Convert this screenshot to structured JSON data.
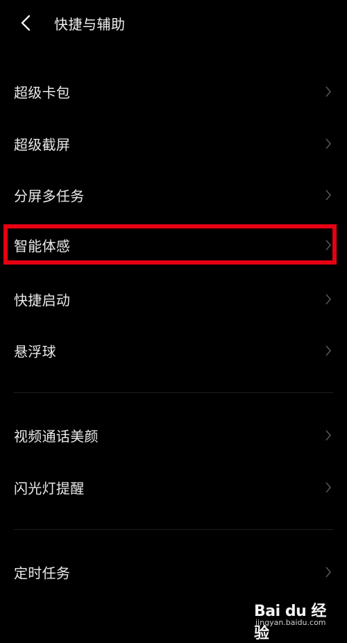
{
  "header": {
    "title": "快捷与辅助",
    "back_icon": "chevron-left-icon"
  },
  "groups": [
    {
      "items": [
        {
          "label": "超级卡包"
        },
        {
          "label": "超级截屏"
        },
        {
          "label": "分屏多任务"
        },
        {
          "label": "智能体感",
          "highlighted": true
        },
        {
          "label": "快捷启动"
        },
        {
          "label": "悬浮球"
        }
      ]
    },
    {
      "items": [
        {
          "label": "视频通话美颜"
        },
        {
          "label": "闪光灯提醒"
        }
      ]
    },
    {
      "items": [
        {
          "label": "定时任务"
        }
      ]
    }
  ],
  "chevron_icon": "chevron-right-icon",
  "colors": {
    "background": "#000000",
    "text": "#eaeaea",
    "chevron": "#555555",
    "highlight_border": "#e60012"
  },
  "watermark": {
    "brand": "Bai du 经验",
    "url": "jingyan.baidu.com"
  }
}
